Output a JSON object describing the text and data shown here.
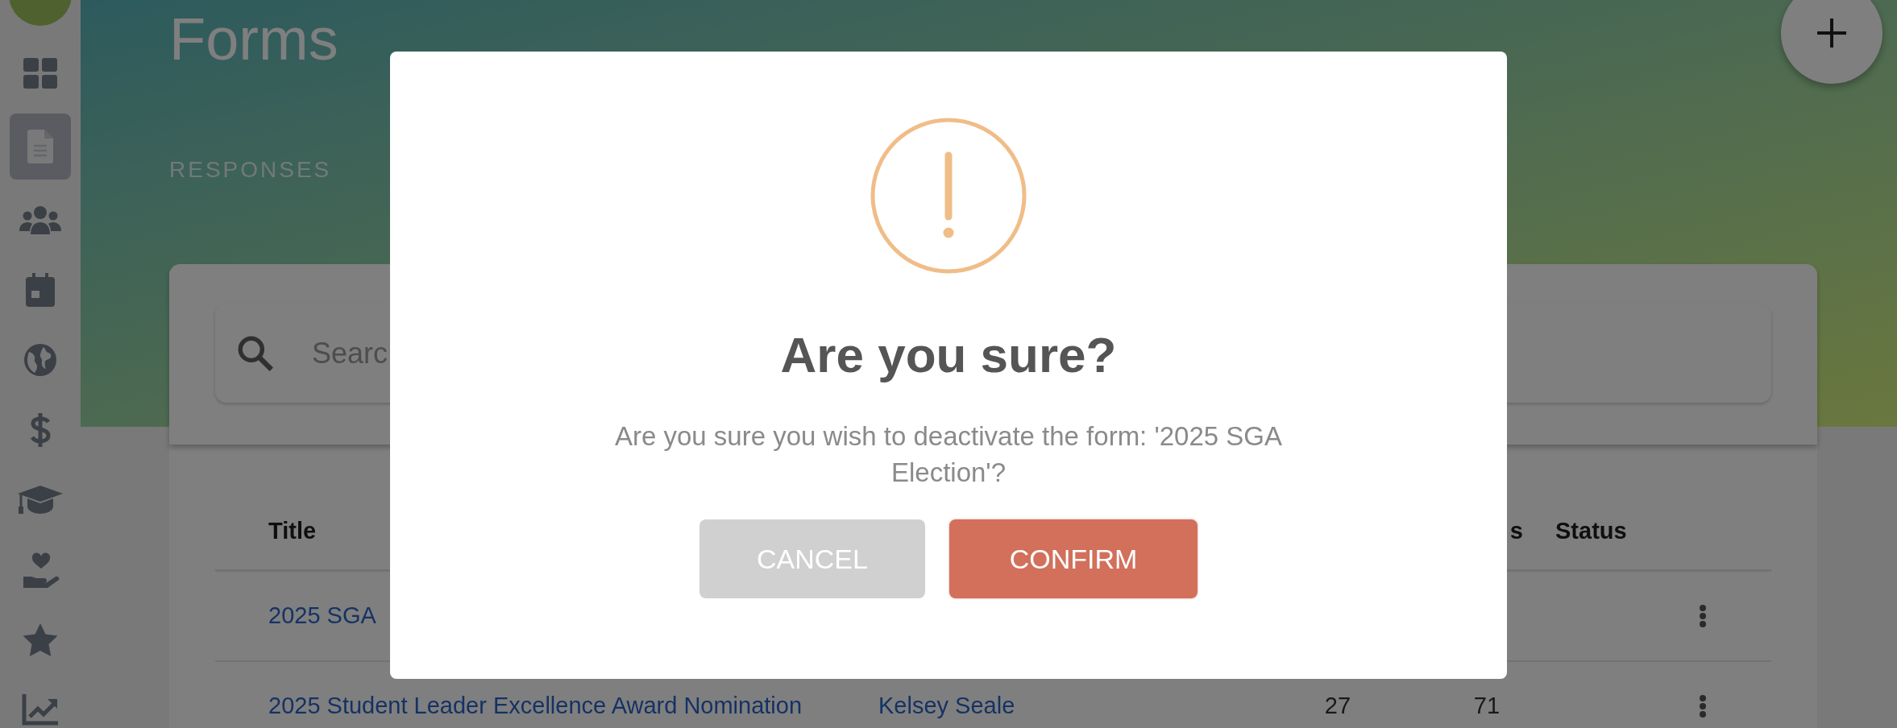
{
  "sidebar": {
    "items": [
      {
        "kind": "dashboard",
        "selected": false
      },
      {
        "kind": "document",
        "selected": true
      },
      {
        "kind": "people",
        "selected": false
      },
      {
        "kind": "calendar",
        "selected": false
      },
      {
        "kind": "globe",
        "selected": false
      },
      {
        "kind": "dollar",
        "selected": false
      },
      {
        "kind": "graduation",
        "selected": false
      },
      {
        "kind": "charity",
        "selected": false
      },
      {
        "kind": "star",
        "selected": false
      },
      {
        "kind": "chart",
        "selected": false
      }
    ]
  },
  "header": {
    "title": "Forms",
    "tab": "RESPONSES"
  },
  "search": {
    "placeholder": "Searc"
  },
  "table": {
    "columns": {
      "title": "Title",
      "column_4": "s",
      "status": "Status"
    },
    "rows": [
      {
        "title": "2025 SGA"
      },
      {
        "title": "2025 Student Leader Excellence Award Nomination",
        "column_2": "Kelsey Seale",
        "column_3": "27",
        "column_4": "71"
      }
    ]
  },
  "dialog": {
    "title": "Are you sure?",
    "message": "Are you sure you wish to deactivate the form: '2025 SGA Election'?",
    "buttons": [
      {
        "kind": "cancel",
        "label": "CANCEL"
      },
      {
        "kind": "confirm",
        "label": "CONFIRM"
      }
    ]
  }
}
